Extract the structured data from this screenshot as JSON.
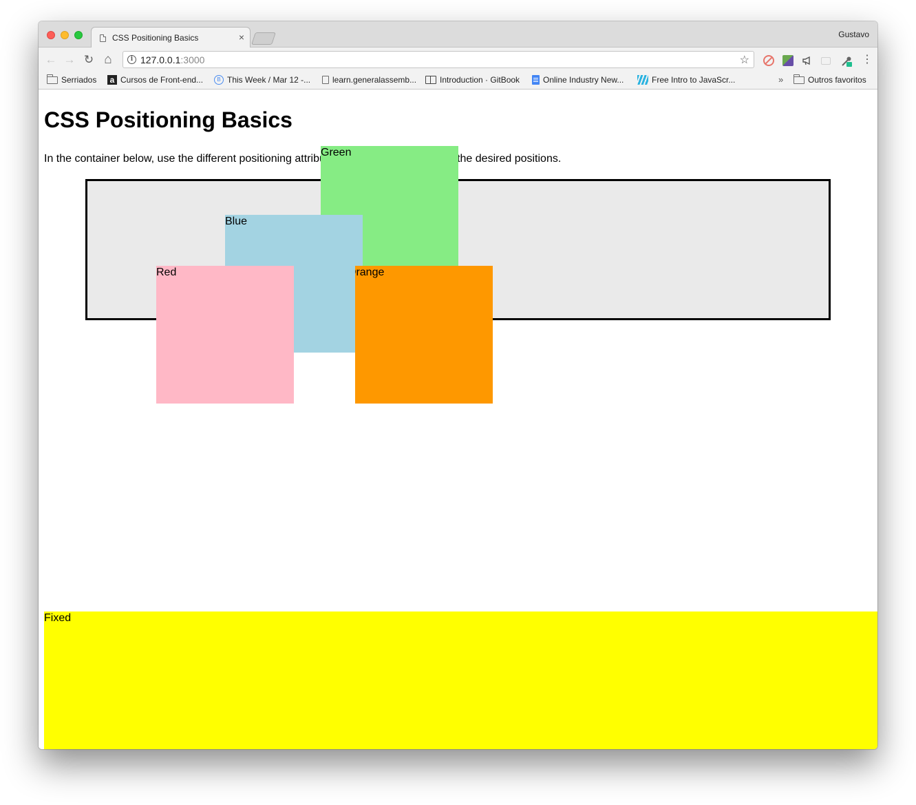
{
  "browser": {
    "tab_title": "CSS Positioning Basics",
    "tab_close": "×",
    "profile_name": "Gustavo",
    "url_host": "127.0.0.1",
    "url_port": ":3000",
    "nav": {
      "back": "←",
      "forward": "→",
      "reload": "↻",
      "home": "⌂",
      "star": "☆",
      "menu": "⋮",
      "info": "i"
    },
    "bookmarks": [
      {
        "label": "Serriados",
        "icon": "folder-icon"
      },
      {
        "label": "Cursos de Front-end...",
        "icon": "a-icon"
      },
      {
        "label": "This Week / Mar 12 -...",
        "icon": "b-icon"
      },
      {
        "label": "learn.generalassemb...",
        "icon": "doc-icon"
      },
      {
        "label": "Introduction · GitBook",
        "icon": "book-icon"
      },
      {
        "label": "Online Industry New...",
        "icon": "gdoc-icon"
      },
      {
        "label": "Free Intro to JavaScr...",
        "icon": "fcc-icon"
      }
    ],
    "bookmarks_overflow": "»",
    "other_bookmarks": "Outros favoritos",
    "extensions": [
      "blocked-icon",
      "colorful-square-icon",
      "megaphone-icon",
      "blank-icon",
      "eyedropper-icon"
    ]
  },
  "page": {
    "title": "CSS Positioning Basics",
    "intro": "In the container below, use the different positioning attributes to move the boxes into the desired positions.",
    "boxes": {
      "green": "Green",
      "blue": "Blue",
      "red": "Red",
      "orange": "Orange",
      "fixed": "Fixed"
    },
    "colors": {
      "green": "#86ec84",
      "blue": "#a3d3e2",
      "red": "#ffb8c6",
      "orange": "#fe9800",
      "fixed": "#ffff00",
      "container": "#eaeaea"
    }
  }
}
